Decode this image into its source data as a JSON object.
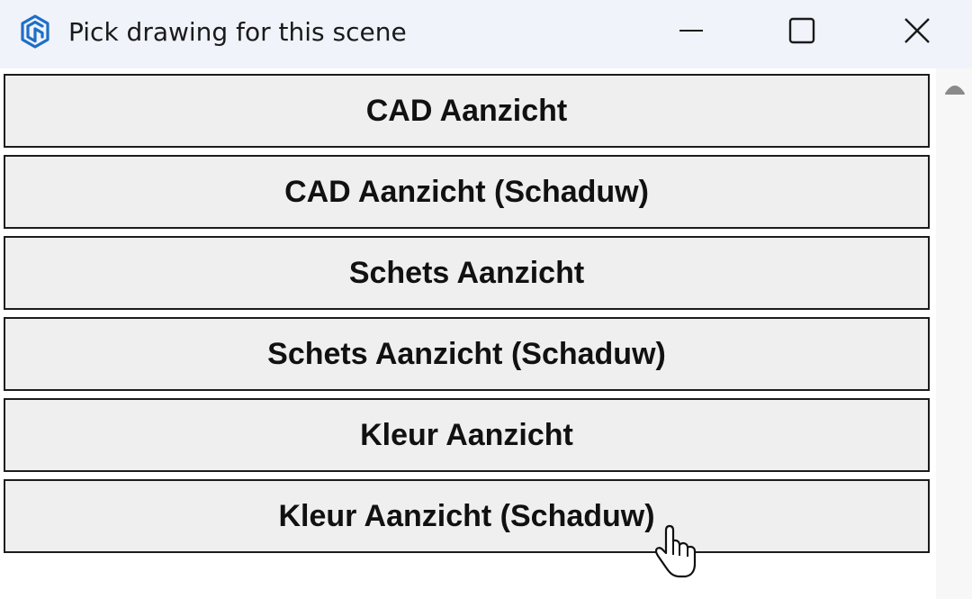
{
  "window": {
    "title": "Pick drawing for this scene",
    "icon": "sketchup-logo-icon",
    "controls": [
      "minimize-icon",
      "maximize-icon",
      "close-icon"
    ]
  },
  "scenes": [
    {
      "label": "CAD Aanzicht"
    },
    {
      "label": "CAD Aanzicht (Schaduw)"
    },
    {
      "label": "Schets Aanzicht"
    },
    {
      "label": "Schets Aanzicht (Schaduw)"
    },
    {
      "label": "Kleur Aanzicht"
    },
    {
      "label": "Kleur Aanzicht (Schaduw)"
    }
  ],
  "colors": {
    "titlebar": "#f0f3f9",
    "button_bg": "#efefef",
    "button_border": "#1c1c1c",
    "icon_blue": "#1e6ec8"
  }
}
